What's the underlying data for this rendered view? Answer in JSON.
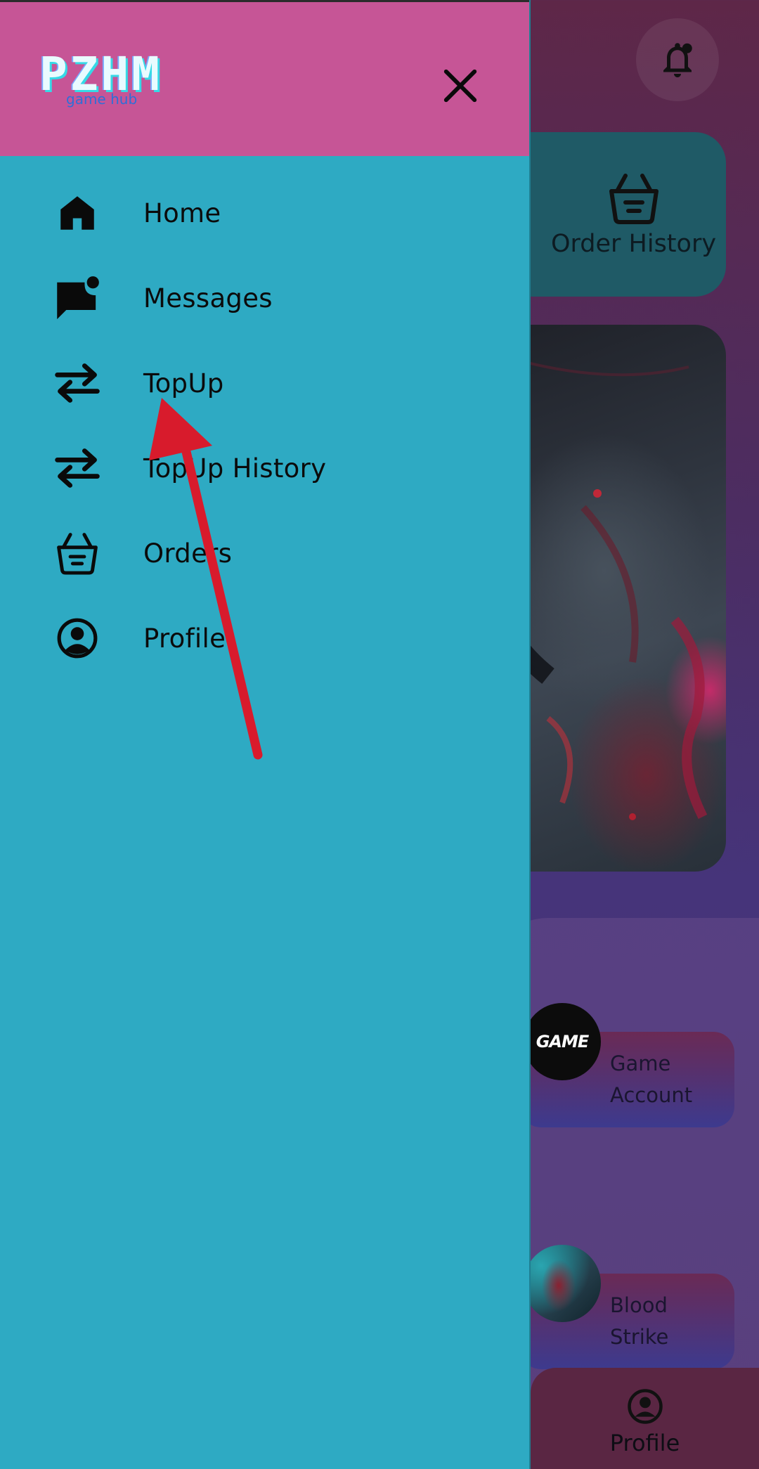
{
  "background": {
    "order_card": {
      "label": "Order History",
      "icon": "basket-icon"
    },
    "notification_icon": "bell-icon",
    "games": [
      {
        "label": "Game\nAccount",
        "avatar_text": "GAME"
      },
      {
        "label": "Blood\nStrike",
        "avatar_text": ""
      }
    ],
    "bottom_nav": {
      "label": "Profile",
      "icon": "profile-icon"
    }
  },
  "drawer": {
    "logo": {
      "main": "PZHM",
      "sub": "game hub"
    },
    "close_icon": "close-icon",
    "menu": [
      {
        "label": "Home",
        "icon": "home-icon"
      },
      {
        "label": "Messages",
        "icon": "message-icon"
      },
      {
        "label": "TopUp",
        "icon": "swap-icon"
      },
      {
        "label": "TopUp History",
        "icon": "swap-icon"
      },
      {
        "label": "Orders",
        "icon": "basket-icon"
      },
      {
        "label": "Profile",
        "icon": "profile-icon"
      }
    ]
  },
  "colors": {
    "drawer_bg": "#2eaac3",
    "drawer_header_bg": "#c65596",
    "annotation_arrow": "#d81b2c"
  }
}
